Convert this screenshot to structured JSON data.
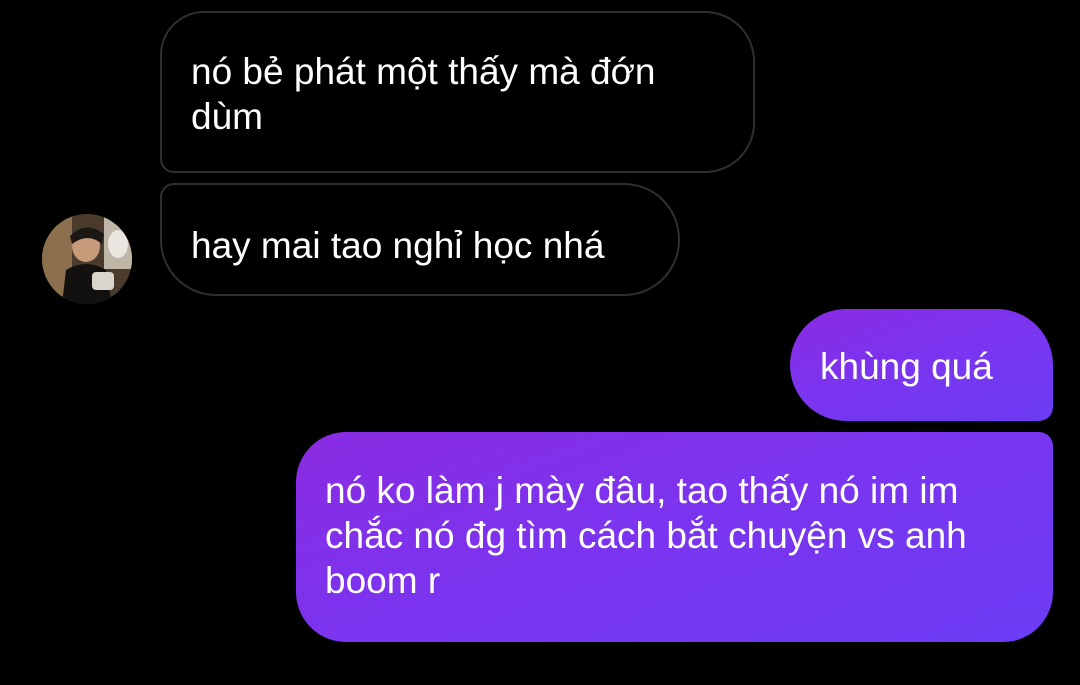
{
  "conversation": {
    "incoming": [
      {
        "text": "nó bẻ phát một thấy mà đớn dùm"
      },
      {
        "text": "hay mai tao nghỉ học nhá"
      }
    ],
    "outgoing": [
      {
        "text": "khùng quá"
      },
      {
        "text": "nó ko làm j mày đâu, tao thấy nó im im chắc nó đg tìm cách bắt chuyện vs anh boom r"
      }
    ]
  },
  "colors": {
    "background": "#000000",
    "incoming_border": "#2f2f2f",
    "outgoing_gradient_start": "#8a2be2",
    "outgoing_gradient_end": "#6c3cf4",
    "text": "#ffffff"
  },
  "icons": {
    "avatar": "contact-avatar-photo"
  }
}
